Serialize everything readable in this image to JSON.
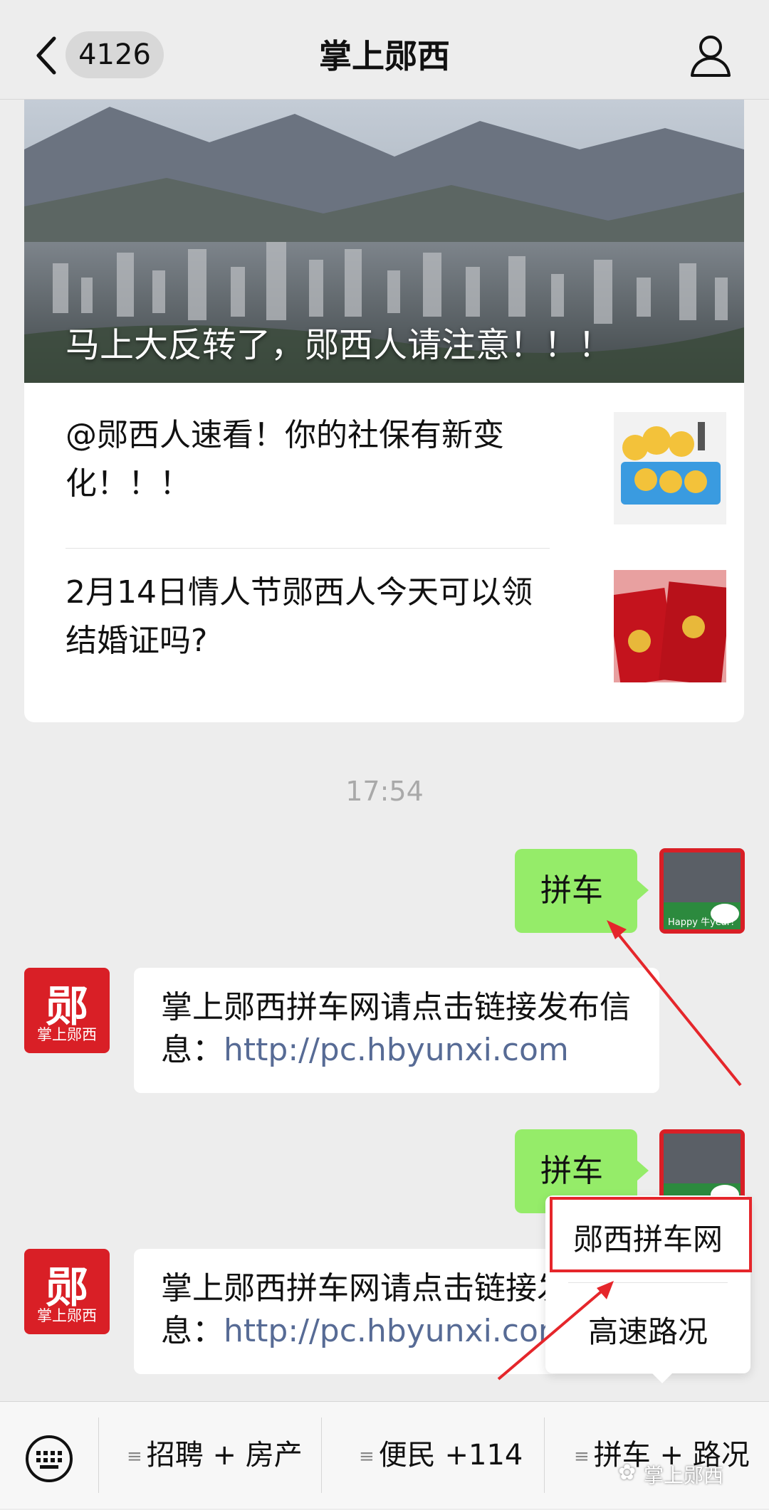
{
  "header": {
    "unread_count": "4126",
    "title": "掌上郧西"
  },
  "article": {
    "cover_title": "马上大反转了，郧西人请注意！！！",
    "items": [
      {
        "title": "@郧西人速看！你的社保有新变化！！！"
      },
      {
        "title": "2月14日情人节郧西人今天可以领结婚证吗?"
      }
    ]
  },
  "chat": {
    "timestamp": "17:54",
    "messages": [
      {
        "from": "me",
        "text": "拼车"
      },
      {
        "from": "bot",
        "text": "掌上郧西拼车网请点击链接发布信息：",
        "link": "http://pc.hbyunxi.com"
      },
      {
        "from": "me",
        "text": "拼车"
      },
      {
        "from": "bot",
        "text": "掌上郧西拼车网请点击链接发布信息：",
        "link": "http://pc.hbyunxi.com"
      }
    ],
    "avatar_text": "Happy 牛year!",
    "logo": {
      "char": "郧",
      "sub": "掌上郧西"
    }
  },
  "popup_menu": {
    "items": [
      "郧西拼车网",
      "高速路况"
    ]
  },
  "bottom_menu": {
    "items": [
      "招聘 + 房产",
      "便民 +114",
      "拼车 + 路况"
    ]
  },
  "watermark": "掌上郧西",
  "colors": {
    "accent_green": "#95ec69",
    "link_blue": "#576b95",
    "annotation_red": "#e5262b",
    "logo_red": "#d91f26"
  }
}
